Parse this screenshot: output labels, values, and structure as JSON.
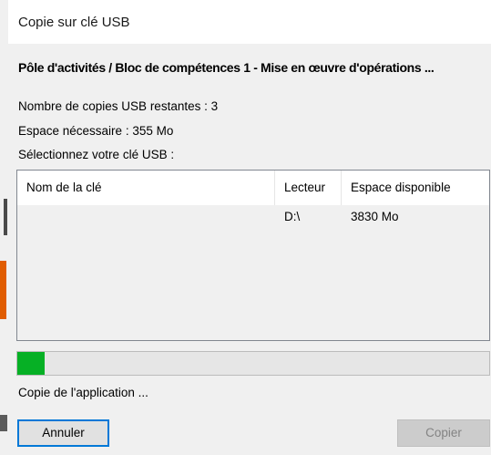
{
  "window": {
    "title": "Copie sur clé USB"
  },
  "course_title": "Pôle d'activités / Bloc de compétences 1 - Mise en œuvre d'opérations ...",
  "info": {
    "remaining_copies": "Nombre de copies USB restantes : 3",
    "space_needed": "Espace nécessaire : 355 Mo",
    "select_prompt": "Sélectionnez votre clé USB  :"
  },
  "usb_list": {
    "columns": [
      "Nom de la clé",
      "Lecteur",
      "Espace disponible"
    ],
    "rows": [
      {
        "name": "",
        "drive": "D:\\",
        "space": "3830 Mo"
      }
    ]
  },
  "progress": {
    "fraction": 0.058,
    "color": "#06b025"
  },
  "status": "Copie de l'application ...",
  "buttons": {
    "cancel": "Annuler",
    "copy": "Copier"
  },
  "colors": {
    "focus_border": "#0078d7",
    "dialog_bg": "#f0f0f0"
  }
}
